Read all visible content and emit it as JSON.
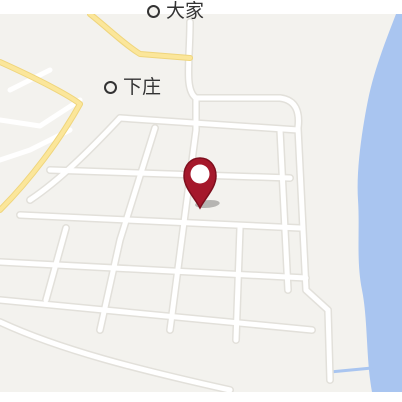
{
  "map": {
    "colors": {
      "land": "#f3f2ee",
      "road": "#ffffff",
      "road_edge": "#e2e0da",
      "major_road": "#fbe69a",
      "major_road_edge": "#efd57c",
      "water": "#a9c5f0",
      "pin": "#a5182b"
    },
    "places": [
      {
        "name": "大家",
        "icon": "circle-marker-icon"
      },
      {
        "name": "下庄",
        "icon": "circle-marker-icon"
      }
    ],
    "marker": {
      "icon": "location-pin-icon"
    }
  }
}
